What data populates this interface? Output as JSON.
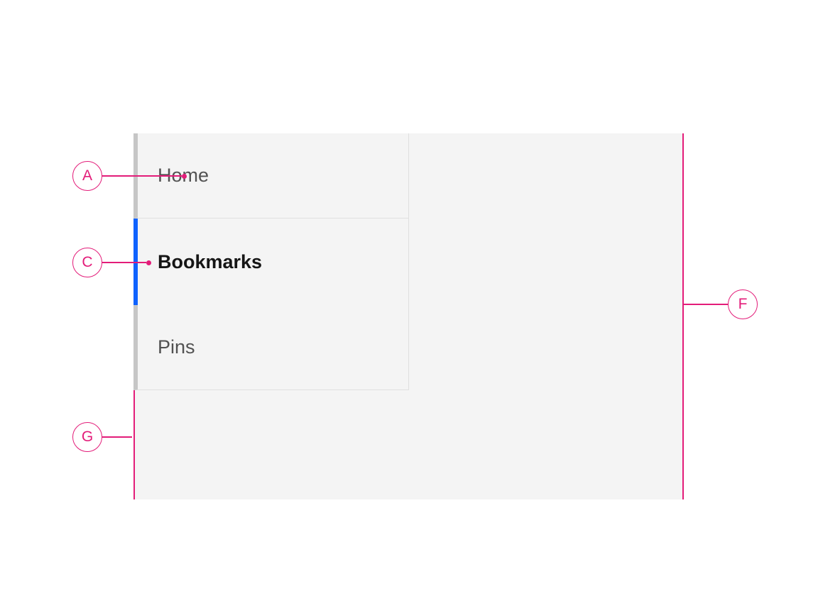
{
  "sidebar": {
    "items": [
      {
        "label": "Home",
        "selected": false
      },
      {
        "label": "Bookmarks",
        "selected": true
      },
      {
        "label": "Pins",
        "selected": false
      }
    ]
  },
  "annotations": {
    "A": "A",
    "C": "C",
    "F": "F",
    "G": "G"
  },
  "colors": {
    "annotation": "#e31c79",
    "active_indicator": "#0f62fe",
    "inactive_indicator": "#c6c6c6",
    "panel_bg": "#f4f4f4"
  }
}
